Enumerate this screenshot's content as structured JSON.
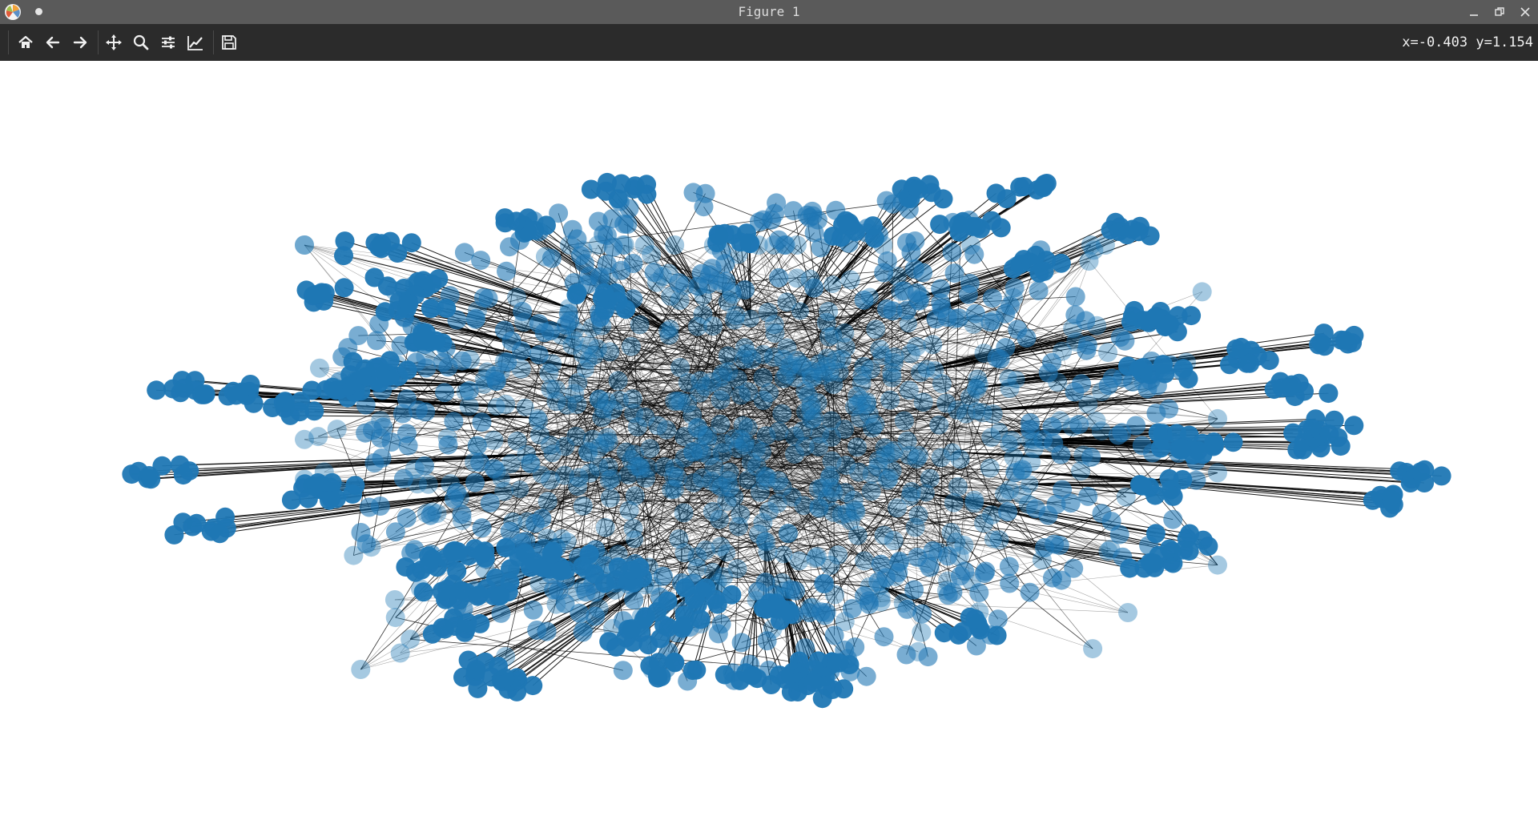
{
  "window": {
    "title": "Figure 1"
  },
  "icons": {
    "app": "matplotlib-logo-icon",
    "dot": "unsaved-dot-icon",
    "minimize": "minimize-icon",
    "restore": "restore-icon",
    "close": "close-icon",
    "home": "home-icon",
    "back": "arrow-left-icon",
    "forward": "arrow-right-icon",
    "pan": "move-icon",
    "zoom": "magnifier-icon",
    "subplots": "sliders-icon",
    "axes": "line-chart-icon",
    "save": "floppy-disk-icon"
  },
  "toolbar": {
    "coordinates": "x=-0.403 y=1.154"
  },
  "colors": {
    "node": "#1f77b4",
    "edge": "#000000",
    "titlebar": "#5a5a5a",
    "toolbar": "#2b2b2b"
  },
  "graph": {
    "type": "network",
    "node_alpha_core": 0.4,
    "node_alpha_leaf": 0.95,
    "hubs": 60,
    "leaves_per_hub": 9,
    "core_nodes": 520
  }
}
